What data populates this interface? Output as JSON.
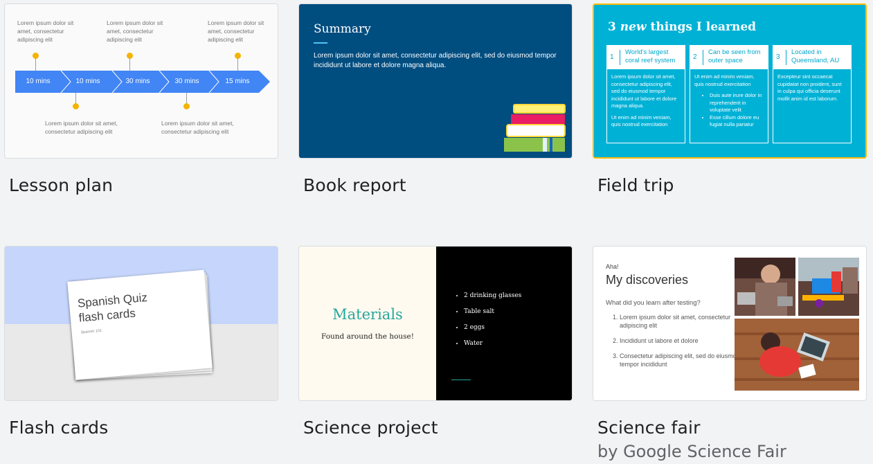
{
  "templates": [
    {
      "label": "Lesson plan",
      "preview": {
        "notes_top": [
          "Lorem ipsum dolor sit amet, consectetur adipiscing elit",
          "Lorem ipsum dolor sit amet, consectetur adipiscing elit",
          "Lorem ipsum dolor sit amet, consectetur adipiscing elit"
        ],
        "notes_bottom": [
          "Lorem ipsum dolor sit amet, consectetur adipiscing elit",
          "Lorem ipsum dolor sit amet, consectetur adipiscing elit"
        ],
        "steps": [
          "10 mins",
          "10 mins",
          "30 mins",
          "30 mins",
          "15 mins"
        ]
      }
    },
    {
      "label": "Book report",
      "preview": {
        "title": "Summary",
        "body": "Lorem ipsum dolor sit amet, consectetur adipiscing elit, sed do eiusmod tempor incididunt ut labore et dolore magna aliqua."
      }
    },
    {
      "label": "Field trip",
      "selected": true,
      "preview": {
        "title_prefix": "3 ",
        "title_em": "new",
        "title_suffix": " things I learned",
        "columns": [
          {
            "num": "1",
            "head": "World's largest coral reef system",
            "p1": "Lorem ipsum dolor sit amet, consectetur adipiscing elit, sed do eiusmod tempor incididunt ut labore et dolore magna aliqua.",
            "p2": "Ut enim ad minim veniam, quis nostrud exercitation"
          },
          {
            "num": "2",
            "head": "Can be seen from outer space",
            "p1": "Ut enim ad minim veniam, quis nostrud exercitation",
            "b1": "Duis aute irure dolor in reprehenderit in voluptate velit",
            "b2": "Esse cillum dolore eu fugiat nulla pariatur"
          },
          {
            "num": "3",
            "head": "Located in Queensland, AU",
            "p1": "Excepteur sint occaecat cupidatat non proident, sunt in culpa qui officia deserunt mollit anim id est laborum."
          }
        ]
      }
    },
    {
      "label": "Flash cards",
      "preview": {
        "title": "Spanish Quiz flash cards",
        "subtitle": "Spanish 101"
      }
    },
    {
      "label": "Science project",
      "preview": {
        "title": "Materials",
        "subtitle": "Found around the house!",
        "items": [
          "2 drinking glasses",
          "Table salt",
          "2 eggs",
          "Water"
        ]
      }
    },
    {
      "label": "Science fair",
      "sublabel": "by Google Science Fair",
      "preview": {
        "kicker": "Aha!",
        "title": "My discoveries",
        "question": "What did you learn after testing?",
        "items": [
          "Lorem ipsum dolor sit amet, consectetur adipiscing elit",
          "Incididunt ut labore et dolore",
          "Consectetur adipiscing elit, sed do eiusmod tempor incididunt"
        ]
      }
    }
  ],
  "colors": {
    "selected_border": "#fbbc04",
    "arrow_blue": "#4285f4",
    "book_report_bg": "#004d80",
    "field_trip_bg": "#00b1d6",
    "teal": "#26a69a"
  }
}
